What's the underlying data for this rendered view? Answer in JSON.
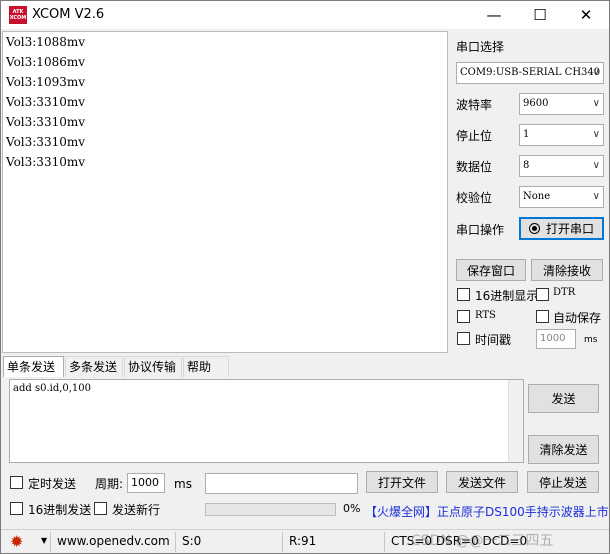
{
  "window": {
    "title": "XCOM V2.6",
    "logo_text": "ATK XCOM"
  },
  "window_controls": {
    "minimize": "—",
    "maximize": "☐",
    "close": "✕"
  },
  "receive": {
    "lines": [
      "Vol3:1088mv",
      "Vol3:1086mv",
      "Vol3:1093mv",
      "Vol3:3310mv",
      "Vol3:3310mv",
      "Vol3:3310mv",
      "Vol3:3310mv"
    ]
  },
  "serial": {
    "port_label": "串口选择",
    "port_value": "COM9:USB-SERIAL CH340",
    "baud_label": "波特率",
    "baud_value": "9600",
    "stop_label": "停止位",
    "stop_value": "1",
    "data_label": "数据位",
    "data_value": "8",
    "parity_label": "校验位",
    "parity_value": "None",
    "op_label": "串口操作",
    "open_button": "打开串口"
  },
  "buttons": {
    "save_window": "保存窗口",
    "clear_receive": "清除接收",
    "send": "发送",
    "clear_send": "清除发送",
    "open_file": "打开文件",
    "send_file": "发送文件",
    "stop_send": "停止发送"
  },
  "options": {
    "hex_display": "16进制显示",
    "dtr": "DTR",
    "rts": "RTS",
    "auto_save": "自动保存",
    "timestamp": "时间戳",
    "timestamp_value": "1000",
    "timestamp_unit": "ms"
  },
  "tabs": [
    "单条发送",
    "多条发送",
    "协议传输",
    "帮助"
  ],
  "send": {
    "text": "add s0.id,0,100"
  },
  "bottom": {
    "timed_send": "定时发送",
    "period_label": "周期:",
    "period_value": "1000",
    "period_unit": "ms",
    "hex_send": "16进制发送",
    "send_newline": "发送新行",
    "progress_text": "0%",
    "ad_text": "【火爆全网】正点原子DS100手持示波器上市"
  },
  "status": {
    "url": "www.openedv.com",
    "s": "S:0",
    "r": "R:91",
    "cts": "CTS=0 DSR=0 DCD=0",
    "watermark": "CSDN @@一二三四五"
  },
  "colors": {
    "ad": "#1b2fd8",
    "gear": "#cc2200",
    "open_btn_border": "#0078d7"
  }
}
